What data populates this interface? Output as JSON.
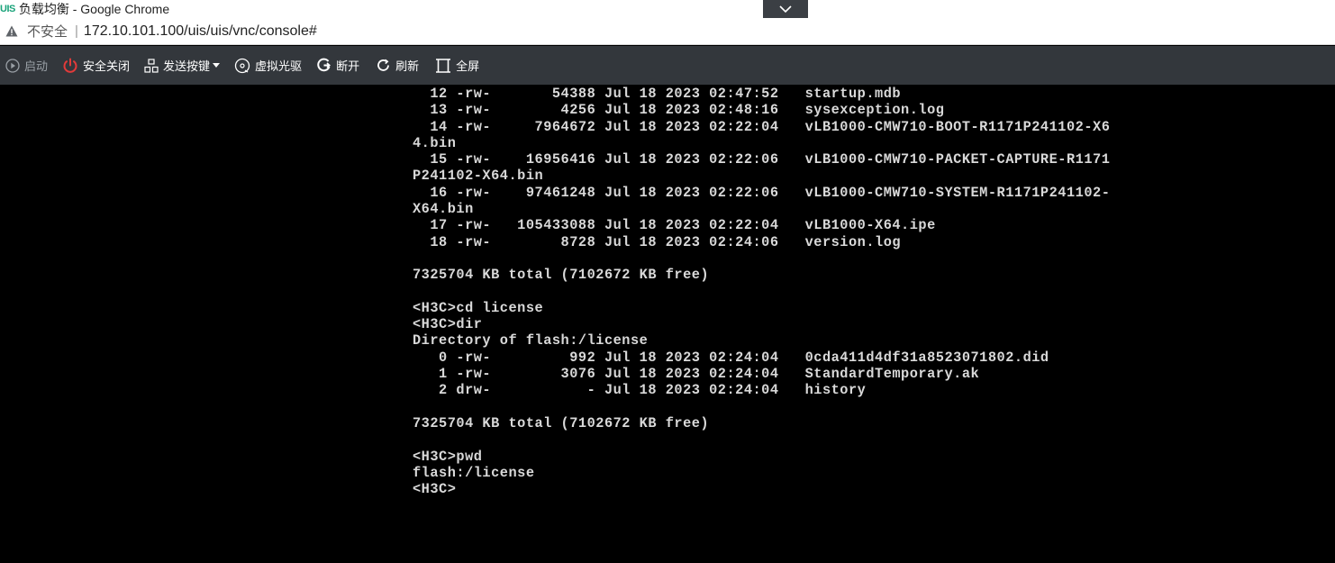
{
  "window": {
    "logo_text": "UIS",
    "title": "负载均衡 - Google Chrome"
  },
  "address": {
    "security_label": "不安全",
    "separator": "|",
    "url": "172.10.101.100/uis/uis/vnc/console#"
  },
  "toolbar": {
    "start_label": "启动",
    "shutdown_label": "安全关闭",
    "send_keys_label": "发送按键",
    "virtual_cd_label": "虚拟光驱",
    "disconnect_label": "断开",
    "refresh_label": "刷新",
    "fullscreen_label": "全屏"
  },
  "console": {
    "lines": [
      "  12 -rw-       54388 Jul 18 2023 02:47:52   startup.mdb",
      "  13 -rw-        4256 Jul 18 2023 02:48:16   sysexception.log",
      "  14 -rw-     7964672 Jul 18 2023 02:22:04   vLB1000-CMW710-BOOT-R1171P241102-X6",
      "4.bin",
      "  15 -rw-    16956416 Jul 18 2023 02:22:06   vLB1000-CMW710-PACKET-CAPTURE-R1171",
      "P241102-X64.bin",
      "  16 -rw-    97461248 Jul 18 2023 02:22:06   vLB1000-CMW710-SYSTEM-R1171P241102-",
      "X64.bin",
      "  17 -rw-   105433088 Jul 18 2023 02:22:04   vLB1000-X64.ipe",
      "  18 -rw-        8728 Jul 18 2023 02:24:06   version.log",
      "",
      "7325704 KB total (7102672 KB free)",
      "",
      "<H3C>cd license",
      "<H3C>dir",
      "Directory of flash:/license",
      "   0 -rw-         992 Jul 18 2023 02:24:04   0cda411d4df31a8523071802.did",
      "   1 -rw-        3076 Jul 18 2023 02:24:04   StandardTemporary.ak",
      "   2 drw-           - Jul 18 2023 02:24:04   history",
      "",
      "7325704 KB total (7102672 KB free)",
      "",
      "<H3C>pwd",
      "flash:/license",
      "<H3C>"
    ]
  }
}
